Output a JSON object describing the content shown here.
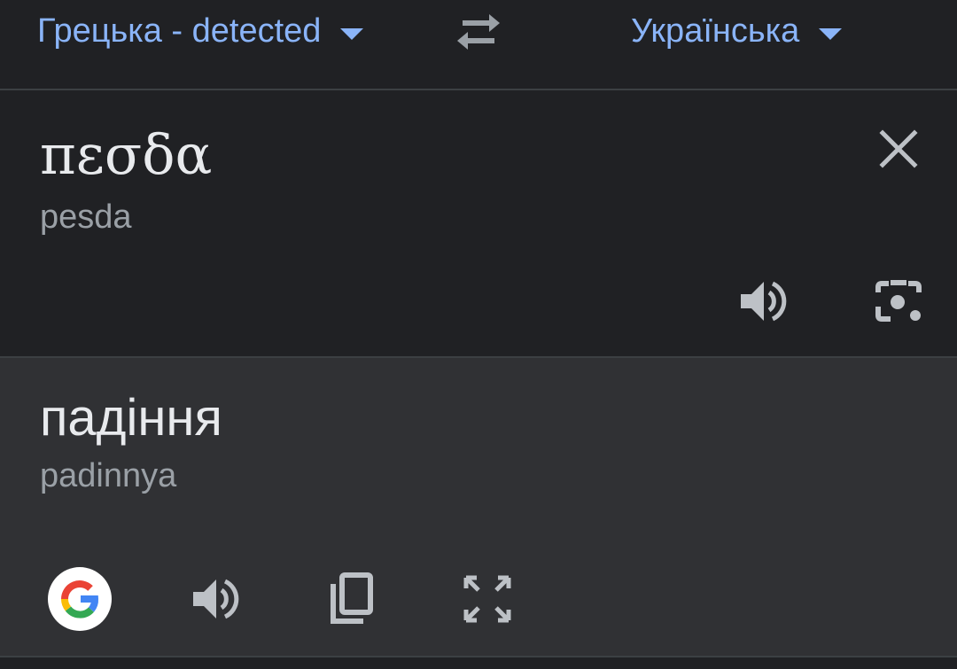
{
  "header": {
    "source_language": "Грецька - detected",
    "target_language": "Українська",
    "icons": {
      "source_dropdown": "chevron-down-icon",
      "swap": "swap-icon",
      "target_dropdown": "chevron-down-icon"
    }
  },
  "source": {
    "text": "πεσδα",
    "transliteration": "pesda",
    "icons": [
      "close-icon",
      "speaker-icon",
      "camera-icon"
    ]
  },
  "result": {
    "text": "падіння",
    "transliteration": "padinnya",
    "icons": [
      "google-logo-icon",
      "speaker-icon",
      "copy-icon",
      "fullscreen-icon"
    ]
  },
  "colors": {
    "background": "#202124",
    "result_background": "#303134",
    "accent": "#8ab4f8",
    "primary_text": "#e8eaed",
    "secondary_text": "#9aa0a6",
    "icon": "#bdc1c6"
  }
}
